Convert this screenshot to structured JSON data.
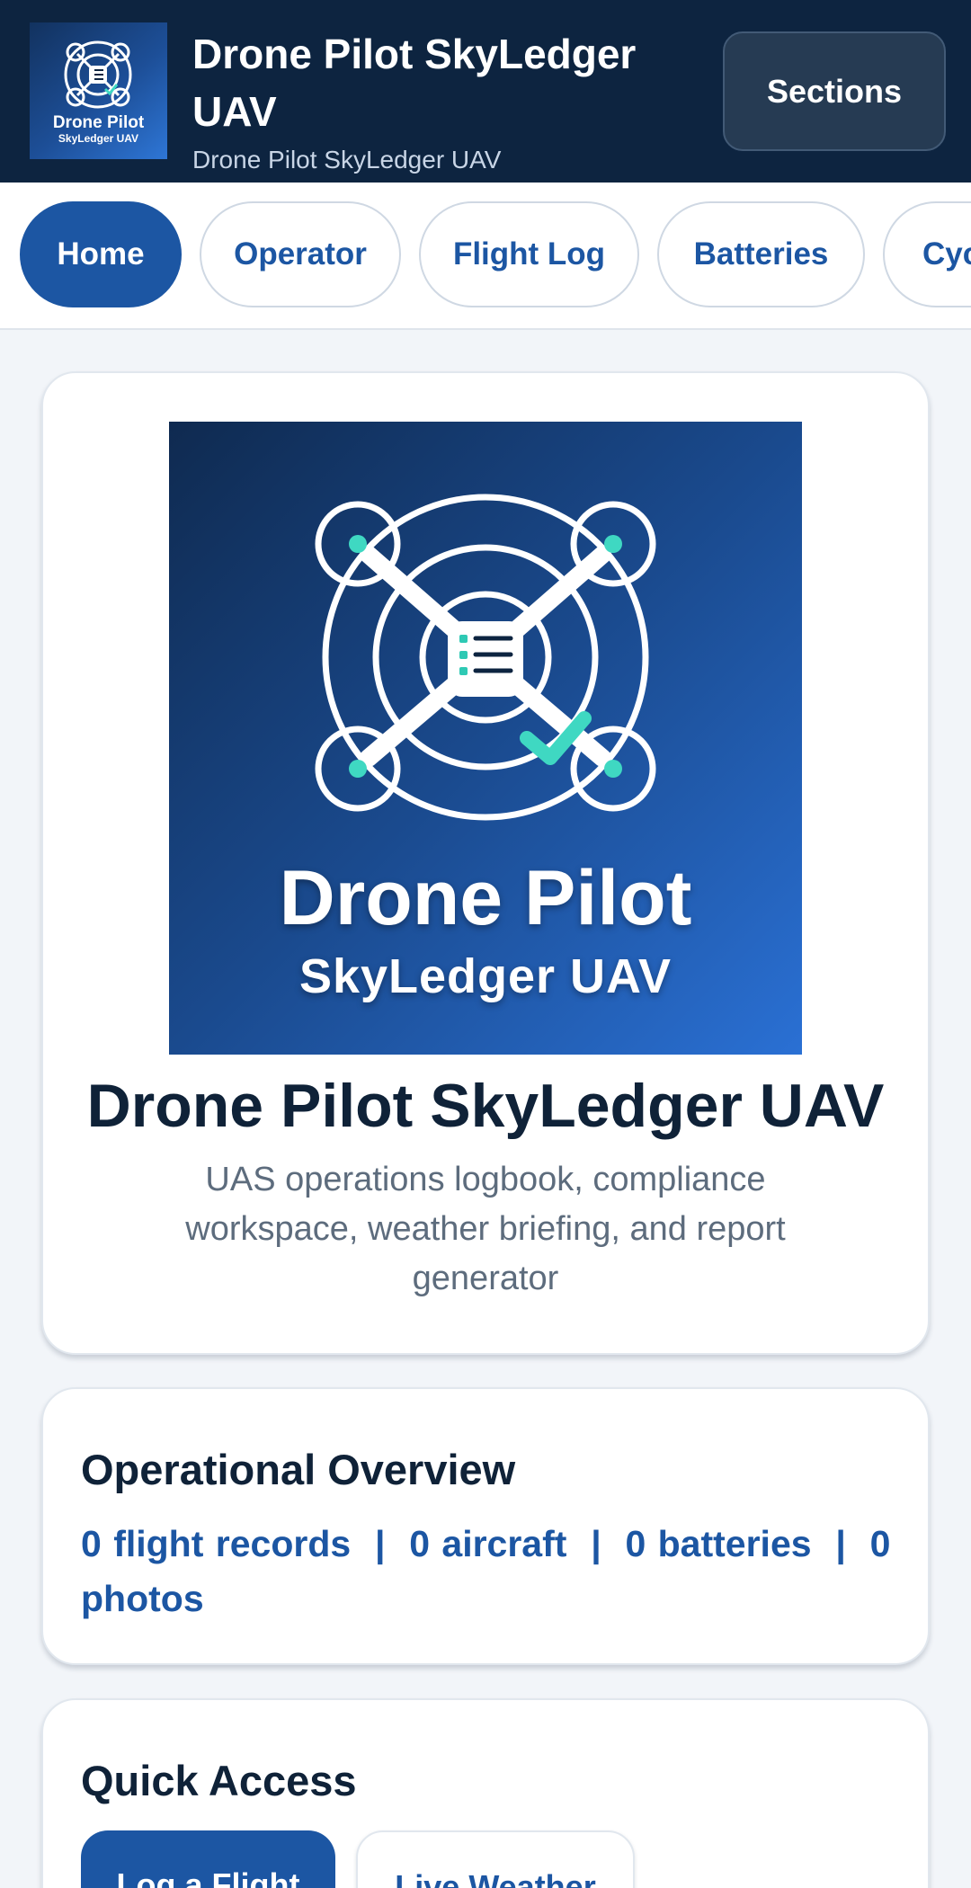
{
  "header": {
    "logo": {
      "line1": "Drone Pilot",
      "line2": "SkyLedger UAV",
      "icon": "drone-logbook-icon"
    },
    "title": "Drone Pilot SkyLedger UAV",
    "subtitle": "Drone Pilot SkyLedger UAV",
    "sections_button_label": "Sections"
  },
  "tabs": [
    {
      "label": "Home",
      "active": true
    },
    {
      "label": "Operator",
      "active": false
    },
    {
      "label": "Flight Log",
      "active": false
    },
    {
      "label": "Batteries",
      "active": false
    },
    {
      "label": "Cyc",
      "active": false
    }
  ],
  "hero": {
    "image_line1": "Drone Pilot",
    "image_line2": "SkyLedger UAV",
    "title": "Drone Pilot SkyLedger UAV",
    "description": "UAS operations logbook, compliance workspace, weather briefing, and report generator"
  },
  "overview": {
    "heading": "Operational Overview",
    "stats": "0 flight records  |  0 aircraft  |  0 batteries  |  0 photos"
  },
  "quick_access": {
    "heading": "Quick Access",
    "buttons": [
      {
        "label": "Log a Flight"
      },
      {
        "label": "Live Weather"
      }
    ]
  },
  "colors": {
    "header_bg": "#0d2440",
    "accent": "#1c56a3",
    "page_bg": "#f2f5f9",
    "drone_accent": "#3fd8c2"
  }
}
